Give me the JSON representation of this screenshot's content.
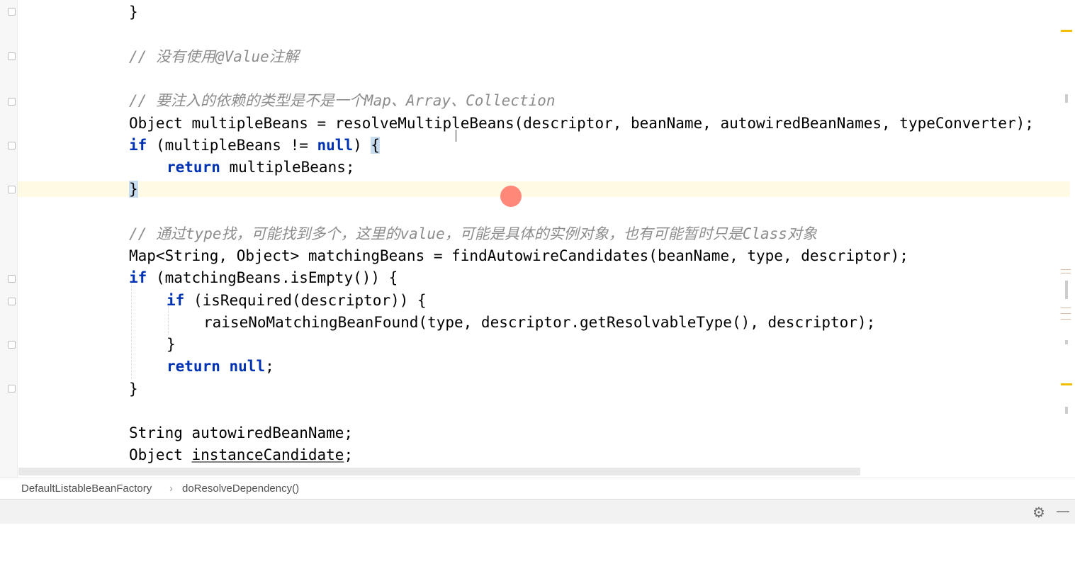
{
  "editor": {
    "lines": {
      "l1": "}",
      "l2": "// 没有使用@Value注解",
      "l3": "// 要注入的依赖的类型是不是一个Map、Array、Collection",
      "l4a": "Object multipleBeans = resolveMultipleBeans(descriptor, beanName, autowiredBeanNames, typeConverter);",
      "l5a": "if",
      "l5b": " (multipleBeans != ",
      "l5c": "null",
      "l5d": ") ",
      "l5e": "{",
      "l6a": "return",
      "l6b": " multipleBeans;",
      "l7": "}",
      "l8": "// 通过type找，可能找到多个，这里的value，可能是具体的实例对象，也有可能暂时只是Class对象",
      "l9": "Map<String, Object> matchingBeans = findAutowireCandidates(beanName, type, descriptor);",
      "l10a": "if",
      "l10b": " (matchingBeans.isEmpty()) {",
      "l11a": "if",
      "l11b": " (isRequired(descriptor)) {",
      "l12": "raiseNoMatchingBeanFound(type, descriptor.getResolvableType(), descriptor);",
      "l13": "}",
      "l14a": "return",
      "l14b": " ",
      "l14c": "null",
      "l14d": ";",
      "l15": "}",
      "l16": "String autowiredBeanName;",
      "l17a": "Object ",
      "l17b": "instanceCandidate",
      "l17c": ";"
    }
  },
  "breadcrumb": {
    "class_name": "DefaultListableBeanFactory",
    "separator": "›",
    "method_name": "doResolveDependency()"
  },
  "toolbar": {
    "settings_icon": "gear-icon",
    "settings_glyph": "⚙",
    "hide_icon": "minimize-icon",
    "hide_glyph": "—"
  },
  "colors": {
    "keyword": "#0033b3",
    "comment": "#8c8c8c",
    "caret_line": "#fffae3",
    "bracket_match": "#c8dcf0"
  }
}
